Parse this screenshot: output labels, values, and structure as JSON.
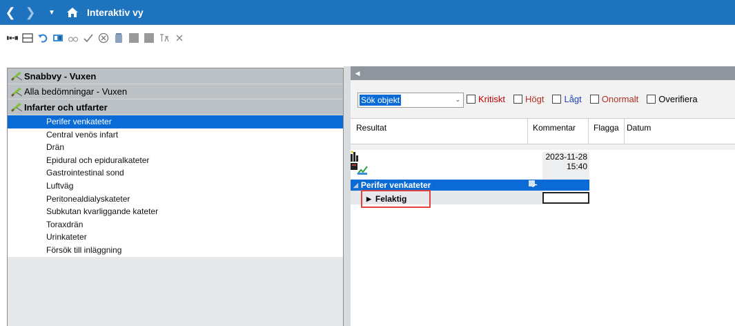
{
  "titlebar": {
    "title": "Interaktiv vy",
    "back_icon": "chevron-left-icon",
    "forward_icon": "chevron-right-icon",
    "dropdown_icon": "caret-down-icon",
    "home_icon": "home-icon"
  },
  "toolbar": {
    "icons": [
      "connect-icon",
      "table-icon",
      "undo-icon",
      "grid-icon",
      "glasses-icon",
      "check-icon",
      "cancel-icon",
      "trash-icon",
      "square-icon",
      "square-icon",
      "translate-icon",
      "close-icon"
    ]
  },
  "left_panel": {
    "categories": [
      {
        "label": "Snabbvy - Vuxen",
        "bold": true
      },
      {
        "label": "Alla bedömningar - Vuxen",
        "bold": false
      },
      {
        "label": "Infarter och utfarter",
        "bold": true
      }
    ],
    "items": [
      "Perifer venkateter",
      "Central venös infart",
      "Drän",
      "Epidural och epiduralkateter",
      "Gastrointestinal sond",
      "Luftväg",
      "Peritonealdialyskateter",
      "Subkutan kvarliggande kateter",
      "Toraxdrän",
      "Urinkateter",
      "Försök till inläggning"
    ],
    "selected_index": 0
  },
  "search": {
    "value": "Sök objekt",
    "flags": [
      {
        "label": "Kritiskt",
        "color": "#c00000"
      },
      {
        "label": "Högt",
        "color": "#b03020"
      },
      {
        "label": "Lågt",
        "color": "#1f3fbf"
      },
      {
        "label": "Onormalt",
        "color": "#b03020"
      },
      {
        "label": "Overifiera",
        "color": "#000000"
      }
    ]
  },
  "grid": {
    "headers": [
      "Resultat",
      "Kommentar",
      "Flagga",
      "Datum"
    ]
  },
  "content": {
    "date": "2023-11-28",
    "time": "15:40",
    "group_label": "Perifer venkateter",
    "row_label": "Felaktig"
  },
  "colors": {
    "titlebar": "#1e73be",
    "selection": "#0a6bd6",
    "highlight_border": "#e04040"
  }
}
